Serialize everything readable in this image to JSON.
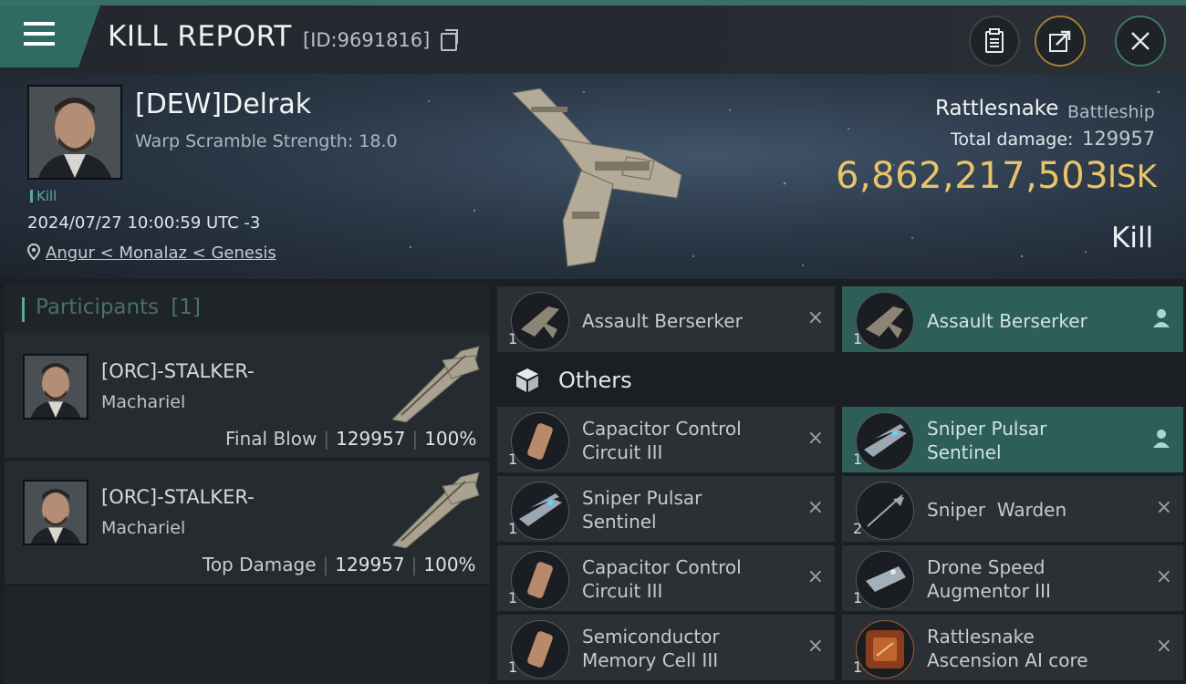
{
  "header": {
    "title": "KILL REPORT",
    "report_id": "[ID:9691816]",
    "icons": [
      "menu-icon",
      "copy-icon",
      "clipboard-icon",
      "share-icon",
      "close-icon"
    ]
  },
  "victim": {
    "name": "[DEW]Delrak",
    "warp_scramble": "Warp Scramble Strength: 18.0",
    "tag": "Kill",
    "datetime": "2024/07/27 10:00:59 UTC -3",
    "location": "Angur < Monalaz < Genesis",
    "ship_name": "Rattlesnake",
    "ship_class": "Battleship",
    "total_damage_label": "Total damage:",
    "total_damage": "129957",
    "isk_value": "6,862,217,503",
    "isk_unit": "ISK",
    "result": "Kill"
  },
  "participants": {
    "title": "Participants",
    "count": "[1]",
    "rows": [
      {
        "name": "[ORC]-STALKER-",
        "ship": "Machariel",
        "role": "Final Blow",
        "damage": "129957",
        "percent": "100%"
      },
      {
        "name": "[ORC]-STALKER-",
        "ship": "Machariel",
        "role": "Top Damage",
        "damage": "129957",
        "percent": "100%"
      }
    ]
  },
  "items": {
    "top_row": [
      {
        "qty": "1",
        "line1": "Assault Berserker",
        "line2": "",
        "teal": false,
        "action": "×"
      },
      {
        "qty": "1",
        "line1": "Assault Berserker",
        "line2": "",
        "teal": true,
        "action": "person"
      }
    ],
    "others_label": "Others",
    "others": [
      {
        "qty": "1",
        "line1": "Capacitor Control",
        "line2": "Circuit III",
        "teal": false,
        "action": "×"
      },
      {
        "qty": "1",
        "line1": "Sniper Pulsar",
        "line2": "Sentinel",
        "teal": true,
        "action": "person"
      },
      {
        "qty": "1",
        "line1": "Sniper Pulsar",
        "line2": "Sentinel",
        "teal": false,
        "action": "×"
      },
      {
        "qty": "2",
        "line1": "Sniper  Warden",
        "line2": "",
        "teal": false,
        "action": "×"
      },
      {
        "qty": "1",
        "line1": "Capacitor Control",
        "line2": "Circuit III",
        "teal": false,
        "action": "×"
      },
      {
        "qty": "1",
        "line1": "Drone Speed",
        "line2": "Augmentor III",
        "teal": false,
        "action": "×"
      },
      {
        "qty": "1",
        "line1": "Semiconductor",
        "line2": "Memory Cell III",
        "teal": false,
        "action": "×"
      },
      {
        "qty": "1",
        "line1": "Rattlesnake",
        "line2": "Ascension AI core",
        "teal": false,
        "action": "×"
      }
    ]
  },
  "colors": {
    "accent_teal": "#2d5e58",
    "isk_gold": "#e8c36a",
    "bg": "#1b1f24"
  }
}
